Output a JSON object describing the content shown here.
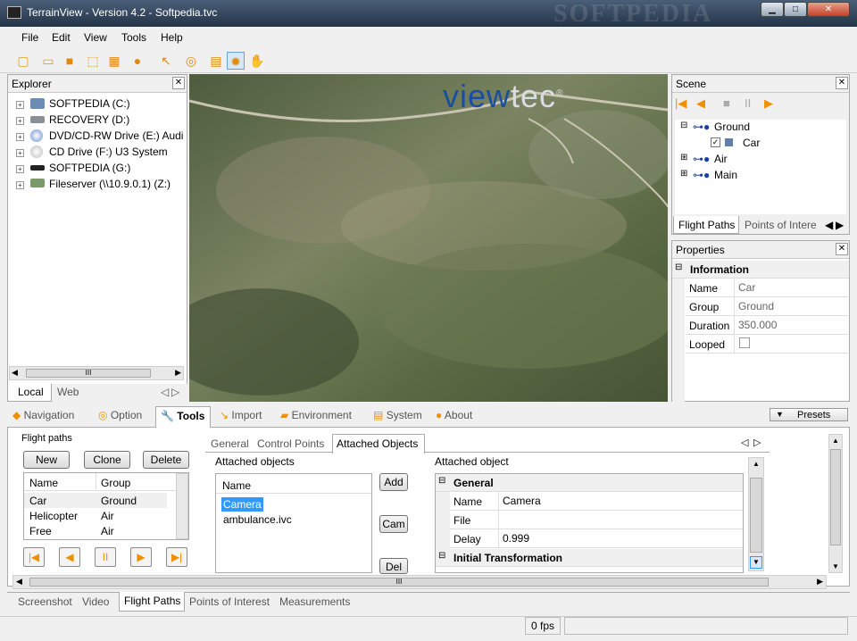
{
  "window": {
    "title": "TerrainView - Version 4.2 - Softpedia.tvc",
    "watermark": "SOFTPEDIA",
    "min": "▁",
    "max": "□",
    "close": "✕"
  },
  "menu": [
    "File",
    "Edit",
    "View",
    "Tools",
    "Help"
  ],
  "toolbar_icons": [
    "new-file-icon",
    "open-folder-icon",
    "save-icon",
    "fit-view-icon",
    "tile-icon",
    "help-icon",
    "pointer-icon",
    "globe-icon",
    "landscape-icon",
    "sun-icon",
    "hand-icon"
  ],
  "explorer": {
    "title": "Explorer",
    "close": "✕",
    "drives": [
      {
        "label": "SOFTPEDIA (C:)",
        "icon": "hard-drive-system-icon"
      },
      {
        "label": "RECOVERY (D:)",
        "icon": "hard-drive-icon"
      },
      {
        "label": "DVD/CD-RW Drive (E:) Audio CD",
        "icon": "dvd-drive-icon"
      },
      {
        "label": "CD Drive (F:) U3 System",
        "icon": "cd-drive-icon"
      },
      {
        "label": "SOFTPEDIA (G:)",
        "icon": "removable-drive-icon"
      },
      {
        "label": "Fileserver (\\\\10.9.0.1) (Z:)",
        "icon": "network-drive-icon"
      }
    ],
    "scroll_grip": "III",
    "tabs": [
      "Local",
      "Web"
    ],
    "arrows": [
      "◁",
      "▷"
    ]
  },
  "viewport": {
    "logo_left": "view",
    "logo_right": "tec",
    "logo_mark": "®"
  },
  "scene": {
    "title": "Scene",
    "close": "✕",
    "tree": [
      {
        "label": "Ground",
        "expand": "⊟"
      },
      {
        "label": "Car",
        "checked": "✓"
      },
      {
        "label": "Air",
        "expand": "⊞"
      },
      {
        "label": "Main",
        "expand": "⊞"
      }
    ],
    "tabs": [
      "Flight Paths",
      "Points of Intere"
    ],
    "arrows": [
      "◀",
      "▶"
    ]
  },
  "properties": {
    "title": "Properties",
    "close": "✕",
    "group": "Information",
    "collapse": "⊟",
    "rows": [
      {
        "name": "Name",
        "value": "Car"
      },
      {
        "name": "Group",
        "value": "Ground"
      },
      {
        "name": "Duration",
        "value": "350.000"
      },
      {
        "name": "Looped",
        "value": ""
      }
    ]
  },
  "bottom_tabs": [
    "Navigation",
    "Option",
    "Tools",
    "Import",
    "Environment",
    "System",
    "About"
  ],
  "presets": {
    "label": "Presets",
    "arrow": "▼"
  },
  "flight_paths": {
    "title": "Flight paths",
    "buttons": [
      "New",
      "Clone",
      "Delete"
    ],
    "headers": [
      "Name",
      "Group"
    ],
    "rows": [
      {
        "name": "Car",
        "group": "Ground"
      },
      {
        "name": "Helicopter",
        "group": "Air"
      },
      {
        "name": "Free",
        "group": "Air"
      }
    ],
    "nav": [
      "|◀",
      "◀",
      "II",
      "▶",
      "▶|"
    ]
  },
  "sub_tabs": [
    "General",
    "Control Points",
    "Attached Objects"
  ],
  "attached_objects": {
    "title": "Attached objects",
    "header": "Name",
    "items": [
      "Camera",
      "ambulance.ivc"
    ],
    "buttons": [
      "Add",
      "Cam",
      "Del"
    ]
  },
  "attached_object": {
    "title": "Attached object",
    "sections": [
      {
        "title": "General",
        "collapse": "⊟",
        "rows": [
          {
            "name": "Name",
            "value": "Camera"
          },
          {
            "name": "File",
            "value": ""
          },
          {
            "name": "Delay",
            "value": "0.999"
          }
        ]
      },
      {
        "title": "Initial Transformation",
        "collapse": "⊟",
        "rows": []
      }
    ]
  },
  "h_scroll_grip": "III",
  "view_tabs": [
    "Screenshot",
    "Video",
    "Flight Paths",
    "Points of Interest",
    "Measurements"
  ],
  "status": {
    "fps": "0 fps"
  },
  "colors": {
    "accent": "#3399ff",
    "nav_orange": "#f09000",
    "title_dark": "#243447"
  }
}
